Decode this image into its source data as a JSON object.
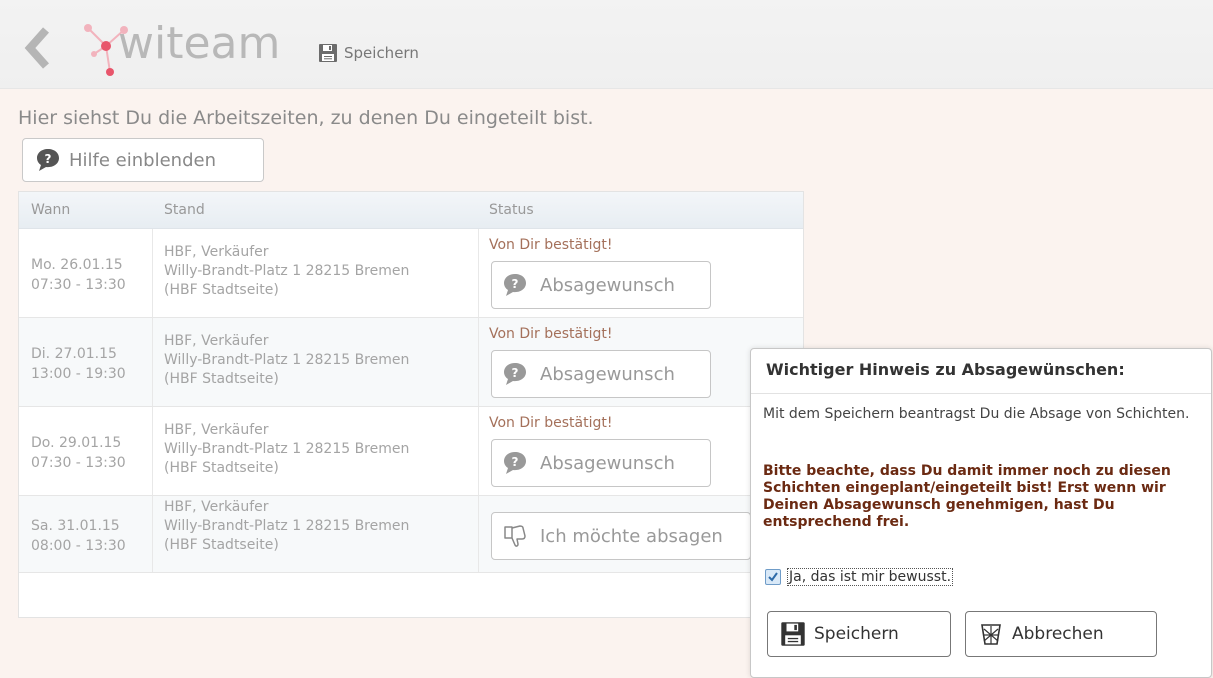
{
  "header": {
    "app_name": "witeam",
    "save_label": "Speichern"
  },
  "intro_text": "Hier siehst Du die Arbeitszeiten, zu denen Du eingeteilt bist.",
  "help_button_label": "Hilfe einblenden",
  "table": {
    "columns": [
      "Wann",
      "Stand",
      "Status"
    ],
    "rows": [
      {
        "day": "Mo. 26.01.15",
        "time": "07:30 - 13:30",
        "stand1": "HBF, Verkäufer",
        "stand2": "Willy-Brandt-Platz 1 28215 Bremen",
        "stand3": "(HBF Stadtseite)",
        "status": "Von Dir bestätigt!",
        "action": "Absagewunsch"
      },
      {
        "day": "Di. 27.01.15",
        "time": "13:00 - 19:30",
        "stand1": "HBF, Verkäufer",
        "stand2": "Willy-Brandt-Platz 1 28215 Bremen",
        "stand3": "(HBF Stadtseite)",
        "status": "Von Dir bestätigt!",
        "action": "Absagewunsch"
      },
      {
        "day": "Do. 29.01.15",
        "time": "07:30 - 13:30",
        "stand1": "HBF, Verkäufer",
        "stand2": "Willy-Brandt-Platz 1 28215 Bremen",
        "stand3": "(HBF Stadtseite)",
        "status": "Von Dir bestätigt!",
        "action": "Absagewunsch"
      },
      {
        "day": "Sa. 31.01.15",
        "time": "08:00 - 13:30",
        "stand1": "HBF, Verkäufer",
        "stand2": "Willy-Brandt-Platz 1 28215 Bremen",
        "stand3": "(HBF Stadtseite)",
        "status": "",
        "action": "Ich möchte absagen"
      }
    ]
  },
  "popup": {
    "title": "Wichtiger Hinweis zu Absagewünschen:",
    "text": "Mit dem Speichern beantragst Du die Absage von Schichten.",
    "warning": "Bitte beachte, dass Du damit immer noch zu diesen Schichten eingeplant/eingeteilt bist! Erst wenn wir Deinen Absagewunsch genehmigen, hast Du entsprechend frei.",
    "checkbox_label": "Ja, das ist mir bewusst.",
    "checkbox_checked": true,
    "save_label": "Speichern",
    "cancel_label": "Abbrechen"
  },
  "colors": {
    "status_text": "#a4705a",
    "warning_text": "#6b2a12",
    "logo_accent": "#e8556b"
  },
  "icons": {
    "back": "chevron-left-icon",
    "save": "floppy-disk-icon",
    "help": "speech-bubble-question-icon",
    "absage": "thumbs-down-icon",
    "cancel": "trash-bin-icon"
  }
}
